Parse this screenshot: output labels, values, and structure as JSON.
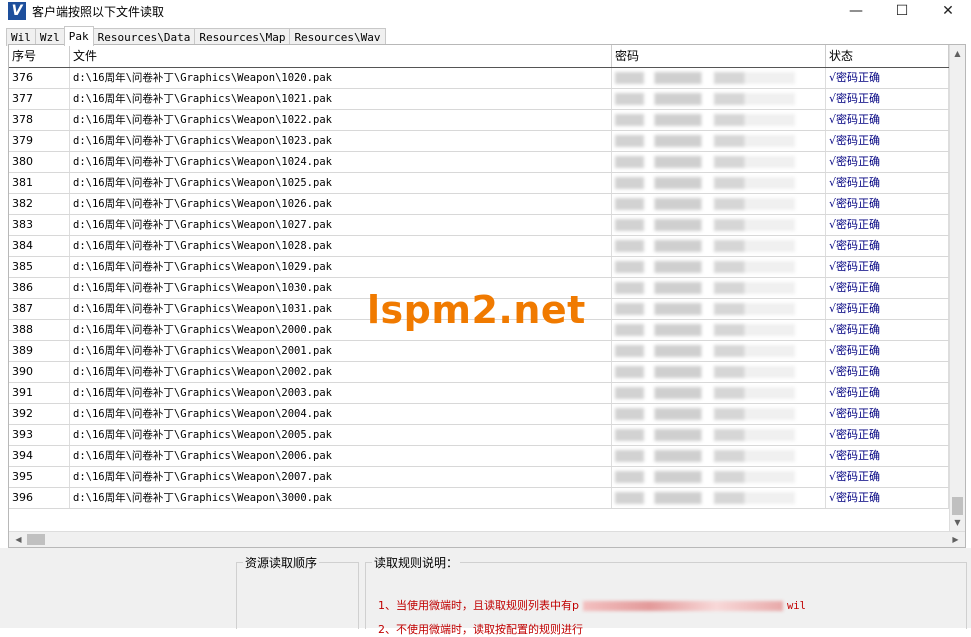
{
  "window": {
    "title": "客户端按照以下文件读取",
    "icon": "app-logo-icon"
  },
  "controls": {
    "minimize": "—",
    "maximize": "☐",
    "close": "✕"
  },
  "tabs": [
    {
      "label": "Wil",
      "active": false
    },
    {
      "label": "Wzl",
      "active": false
    },
    {
      "label": "Pak",
      "active": true
    },
    {
      "label": "Resources\\Data",
      "active": false
    },
    {
      "label": "Resources\\Map",
      "active": false
    },
    {
      "label": "Resources\\Wav",
      "active": false
    }
  ],
  "table": {
    "columns": [
      "序号",
      "文件",
      "密码",
      "状态"
    ],
    "rows": [
      {
        "id": "376",
        "file": "d:\\16周年\\问卷补丁\\Graphics\\Weapon\\1020.pak",
        "status": "√密码正确"
      },
      {
        "id": "377",
        "file": "d:\\16周年\\问卷补丁\\Graphics\\Weapon\\1021.pak",
        "status": "√密码正确"
      },
      {
        "id": "378",
        "file": "d:\\16周年\\问卷补丁\\Graphics\\Weapon\\1022.pak",
        "status": "√密码正确"
      },
      {
        "id": "379",
        "file": "d:\\16周年\\问卷补丁\\Graphics\\Weapon\\1023.pak",
        "status": "√密码正确"
      },
      {
        "id": "380",
        "file": "d:\\16周年\\问卷补丁\\Graphics\\Weapon\\1024.pak",
        "status": "√密码正确"
      },
      {
        "id": "381",
        "file": "d:\\16周年\\问卷补丁\\Graphics\\Weapon\\1025.pak",
        "status": "√密码正确"
      },
      {
        "id": "382",
        "file": "d:\\16周年\\问卷补丁\\Graphics\\Weapon\\1026.pak",
        "status": "√密码正确"
      },
      {
        "id": "383",
        "file": "d:\\16周年\\问卷补丁\\Graphics\\Weapon\\1027.pak",
        "status": "√密码正确"
      },
      {
        "id": "384",
        "file": "d:\\16周年\\问卷补丁\\Graphics\\Weapon\\1028.pak",
        "status": "√密码正确"
      },
      {
        "id": "385",
        "file": "d:\\16周年\\问卷补丁\\Graphics\\Weapon\\1029.pak",
        "status": "√密码正确"
      },
      {
        "id": "386",
        "file": "d:\\16周年\\问卷补丁\\Graphics\\Weapon\\1030.pak",
        "status": "√密码正确"
      },
      {
        "id": "387",
        "file": "d:\\16周年\\问卷补丁\\Graphics\\Weapon\\1031.pak",
        "status": "√密码正确"
      },
      {
        "id": "388",
        "file": "d:\\16周年\\问卷补丁\\Graphics\\Weapon\\2000.pak",
        "status": "√密码正确"
      },
      {
        "id": "389",
        "file": "d:\\16周年\\问卷补丁\\Graphics\\Weapon\\2001.pak",
        "status": "√密码正确"
      },
      {
        "id": "390",
        "file": "d:\\16周年\\问卷补丁\\Graphics\\Weapon\\2002.pak",
        "status": "√密码正确"
      },
      {
        "id": "391",
        "file": "d:\\16周年\\问卷补丁\\Graphics\\Weapon\\2003.pak",
        "status": "√密码正确"
      },
      {
        "id": "392",
        "file": "d:\\16周年\\问卷补丁\\Graphics\\Weapon\\2004.pak",
        "status": "√密码正确"
      },
      {
        "id": "393",
        "file": "d:\\16周年\\问卷补丁\\Graphics\\Weapon\\2005.pak",
        "status": "√密码正确"
      },
      {
        "id": "394",
        "file": "d:\\16周年\\问卷补丁\\Graphics\\Weapon\\2006.pak",
        "status": "√密码正确"
      },
      {
        "id": "395",
        "file": "d:\\16周年\\问卷补丁\\Graphics\\Weapon\\2007.pak",
        "status": "√密码正确"
      },
      {
        "id": "396",
        "file": "d:\\16周年\\问卷补丁\\Graphics\\Weapon\\3000.pak",
        "status": "√密码正确"
      }
    ]
  },
  "watermark": "lspm2.net",
  "bottom": {
    "order_title": "资源读取顺序",
    "rules_title": "读取规则说明：",
    "rule1_prefix": "1、当使用微端时，且读取规则列表中有p",
    "rule1_suffix": "wil",
    "rule2": "2、不使用微端时，读取按配置的规则进行"
  },
  "colors": {
    "status": "#000080",
    "rule": "#c00000",
    "watermark": "#f07a00"
  }
}
